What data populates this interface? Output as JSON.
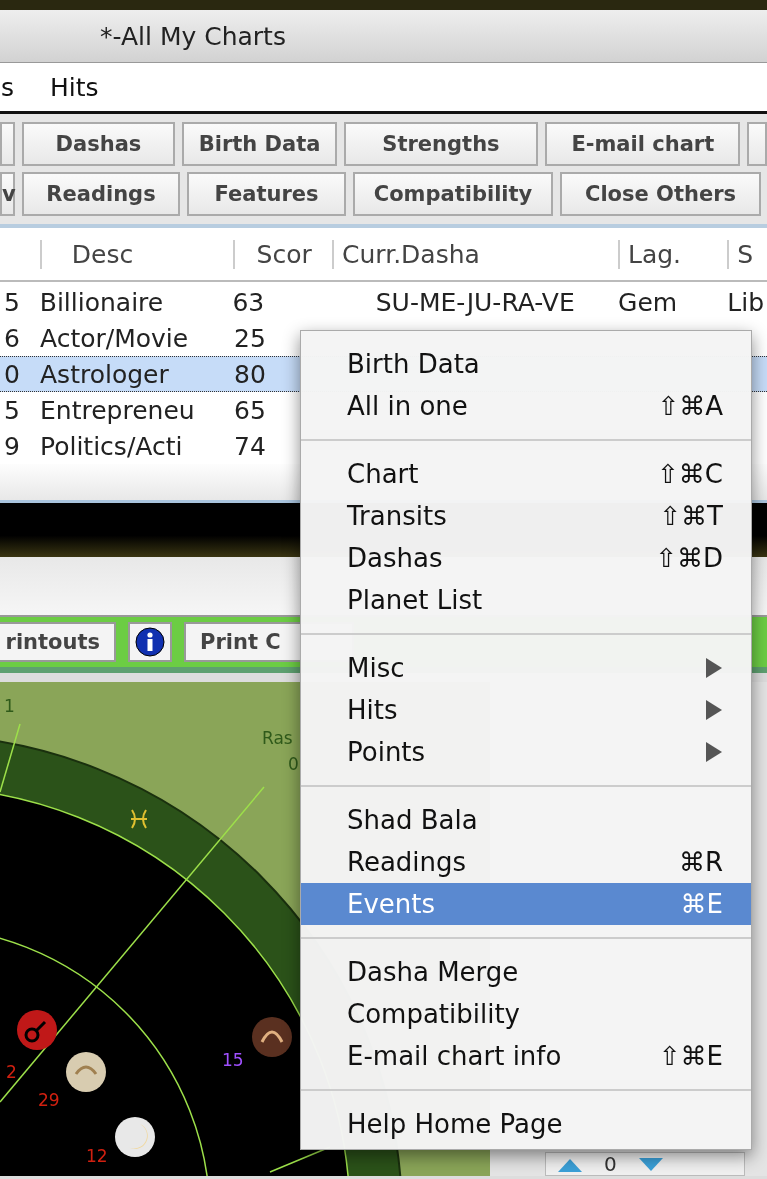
{
  "window": {
    "title": "*-All My Charts"
  },
  "menu_bar": [
    {
      "label": "s"
    },
    {
      "label": "Hits"
    }
  ],
  "toolbar_rows": [
    {
      "buttons": [
        {
          "label": "Dashas"
        },
        {
          "label": "Birth Data"
        },
        {
          "label": "Strengths"
        },
        {
          "label": "E-mail chart"
        }
      ]
    },
    {
      "buttons": [
        {
          "label": "v"
        },
        {
          "label": "Readings"
        },
        {
          "label": "Features"
        },
        {
          "label": "Compatibility"
        },
        {
          "label": "Close Others"
        }
      ]
    }
  ],
  "table": {
    "columns": [
      "",
      "Desc",
      "Scor",
      "Curr.Dasha",
      "Lag.",
      "S"
    ],
    "rows": [
      {
        "selected": false,
        "cells": [
          "5",
          "Billionaire",
          "63",
          "SU-ME-JU-RA-VE",
          "Gem",
          "Lib"
        ]
      },
      {
        "selected": false,
        "cells": [
          "6",
          "Actor/Movie",
          "25"
        ]
      },
      {
        "selected": true,
        "cells": [
          "0",
          "Astrologer",
          "80"
        ]
      },
      {
        "selected": false,
        "cells": [
          "5",
          "Entrepreneu",
          "65"
        ]
      },
      {
        "selected": false,
        "cells": [
          "9",
          "Politics/Acti",
          "74"
        ]
      }
    ]
  },
  "chart_window": {
    "toolbar": [
      {
        "kind": "button",
        "label": "rintouts"
      },
      {
        "kind": "info"
      },
      {
        "kind": "button",
        "label": "Print C"
      }
    ],
    "chart_labels": [
      {
        "text": "1",
        "kind": "house"
      },
      {
        "text": "Ras",
        "kind": "house"
      },
      {
        "text": "0",
        "kind": "house"
      },
      {
        "text": "15",
        "kind": "degree-alt"
      },
      {
        "text": "2",
        "kind": "degree"
      },
      {
        "text": "29",
        "kind": "degree"
      },
      {
        "text": "12",
        "kind": "degree"
      }
    ],
    "stepper": {
      "value": "0"
    }
  },
  "context_menu": [
    {
      "kind": "item",
      "label": "Birth Data",
      "selected": false
    },
    {
      "kind": "item",
      "label": "All in one",
      "shortcut": "⇧⌘A",
      "selected": false
    },
    {
      "kind": "separator"
    },
    {
      "kind": "item",
      "label": "Chart",
      "shortcut": "⇧⌘C",
      "selected": false
    },
    {
      "kind": "item",
      "label": "Transits",
      "shortcut": "⇧⌘T",
      "selected": false
    },
    {
      "kind": "item",
      "label": "Dashas",
      "shortcut": "⇧⌘D",
      "selected": false
    },
    {
      "kind": "item",
      "label": "Planet List",
      "selected": false
    },
    {
      "kind": "separator"
    },
    {
      "kind": "submenu",
      "label": "Misc",
      "selected": false
    },
    {
      "kind": "submenu",
      "label": "Hits",
      "selected": false
    },
    {
      "kind": "submenu",
      "label": "Points",
      "selected": false
    },
    {
      "kind": "separator"
    },
    {
      "kind": "item",
      "label": "Shad Bala",
      "selected": false
    },
    {
      "kind": "item",
      "label": "Readings",
      "shortcut": "⌘R",
      "selected": false
    },
    {
      "kind": "item",
      "label": "Events",
      "shortcut": "⌘E",
      "selected": true
    },
    {
      "kind": "separator"
    },
    {
      "kind": "item",
      "label": "Dasha Merge",
      "selected": false
    },
    {
      "kind": "item",
      "label": "Compatibility",
      "selected": false
    },
    {
      "kind": "item",
      "label": "E-mail chart info",
      "shortcut": "⇧⌘E",
      "selected": false
    },
    {
      "kind": "separator"
    },
    {
      "kind": "item",
      "label": "Help Home Page",
      "selected": false
    }
  ]
}
